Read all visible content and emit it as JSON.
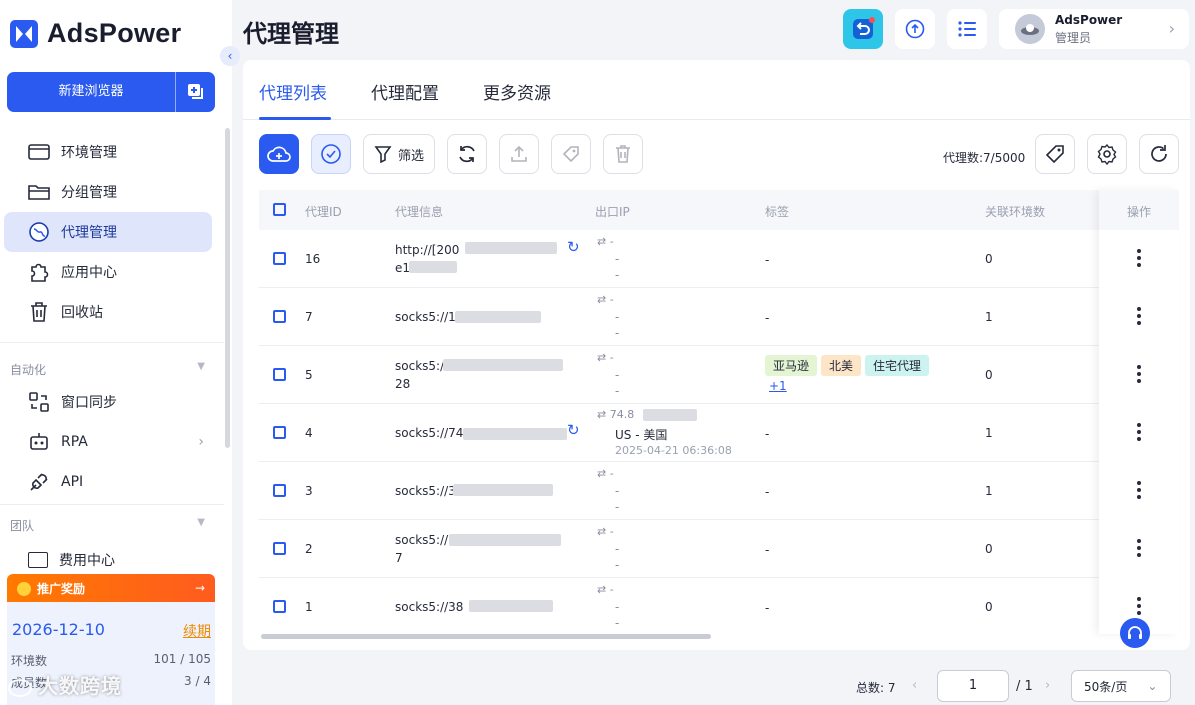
{
  "app": {
    "name": "AdsPower"
  },
  "sidebar": {
    "new_browser": "新建浏览器",
    "nav": [
      "环境管理",
      "分组管理",
      "代理管理",
      "应用中心",
      "回收站"
    ],
    "automation_title": "自动化",
    "automation": [
      "窗口同步",
      "RPA",
      "API"
    ],
    "team_title": "团队",
    "team_partial": "费用中心",
    "promo": "推广奖励",
    "plan_date": "2026-12-10",
    "renew": "续期",
    "env_label": "环境数",
    "env_value": "101 / 105",
    "member_label": "成员数",
    "member_value": "3 / 4"
  },
  "header": {
    "title": "代理管理",
    "user_name": "AdsPower",
    "user_role": "管理员"
  },
  "tabs": [
    "代理列表",
    "代理配置",
    "更多资源"
  ],
  "toolbar": {
    "filter": "筛选",
    "count_label": "代理数:7/5000"
  },
  "table": {
    "headers": [
      "代理ID",
      "代理信息",
      "出口IP",
      "标签",
      "关联环境数",
      "操作"
    ],
    "rows": [
      {
        "id": "16",
        "info": "http://[200",
        "info2": "e1",
        "ip1": "-",
        "ip2": "-",
        "ip3": "-",
        "tag": "-",
        "envs": "0"
      },
      {
        "id": "7",
        "info": "socks5://1",
        "ip1": "-",
        "ip2": "-",
        "ip3": "-",
        "tag": "-",
        "envs": "1"
      },
      {
        "id": "5",
        "info": "socks5:/",
        "info2": "28",
        "ip1": "-",
        "ip2": "-",
        "ip3": "-",
        "tags": [
          "亚马逊",
          "北美",
          "住宅代理"
        ],
        "more": "+1",
        "envs": "0"
      },
      {
        "id": "4",
        "info": "socks5://74",
        "ip1": "74.8",
        "ip2": "US - 美国",
        "ip3": "2025-04-21 06:36:08",
        "tag": "-",
        "envs": "1"
      },
      {
        "id": "3",
        "info": "socks5://3",
        "ip1": "-",
        "ip2": "-",
        "ip3": "-",
        "tag": "-",
        "envs": "1"
      },
      {
        "id": "2",
        "info": "socks5://",
        "info2": "7",
        "ip1": "-",
        "ip2": "-",
        "ip3": "-",
        "tag": "-",
        "envs": "0"
      },
      {
        "id": "1",
        "info": "socks5://38",
        "ip1": "-",
        "ip2": "-",
        "ip3": "-",
        "tag": "-",
        "envs": "0"
      }
    ]
  },
  "pagination": {
    "total": "总数: 7",
    "page": "1",
    "pages": "/ 1",
    "page_size": "50条/页"
  },
  "watermark": "大数跨境",
  "colors": {
    "accent": "#2a5af0",
    "promo": "#ff6a10",
    "renew": "#f08a00"
  }
}
